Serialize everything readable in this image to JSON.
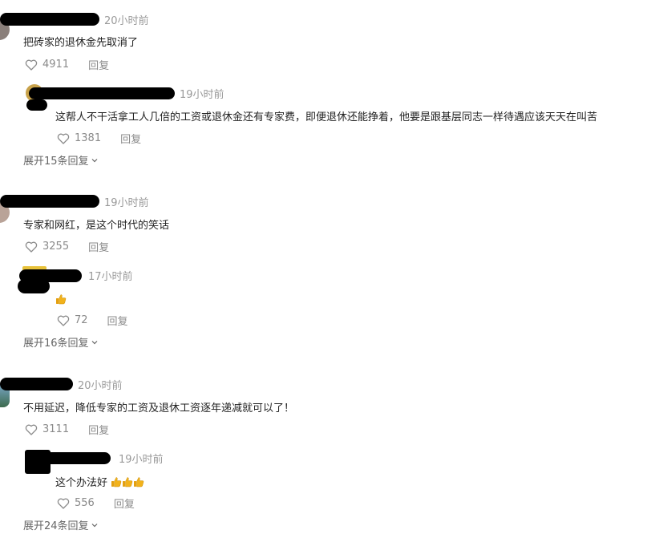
{
  "threads": [
    {
      "comment": {
        "time": "20小时前",
        "text": "把砖家的退休金先取消了",
        "likes": "4911",
        "reply_label": "回复"
      },
      "reply": {
        "time": "19小时前",
        "text": "这帮人不干活拿工人几倍的工资或退休金还有专家费，即便退休还能挣着，他要是跟基层同志一样待遇应该天天在叫苦",
        "likes": "1381",
        "reply_label": "回复"
      },
      "expand_label": "展开15条回复"
    },
    {
      "comment": {
        "time": "19小时前",
        "text": "专家和网红，是这个时代的笑话",
        "likes": "3255",
        "reply_label": "回复"
      },
      "reply": {
        "time": "17小时前",
        "text": "",
        "likes": "72",
        "reply_label": "回复"
      },
      "expand_label": "展开16条回复"
    },
    {
      "comment": {
        "time": "20小时前",
        "text": "不用延迟，降低专家的工资及退休工资逐年递减就可以了！",
        "likes": "3111",
        "reply_label": "回复"
      },
      "reply": {
        "time": "19小时前",
        "text": "这个办法好",
        "likes": "556",
        "reply_label": "回复"
      },
      "expand_label": "展开24条回复"
    }
  ],
  "icons": {
    "like": "heart-outline-icon",
    "expand": "chevron-down-icon",
    "emoji": "thumbs-up-emoji"
  },
  "colors": {
    "time": "#9a9a9a",
    "action": "#8a8a8a",
    "redaction": "#000000",
    "emoji": "#f2b21b"
  }
}
